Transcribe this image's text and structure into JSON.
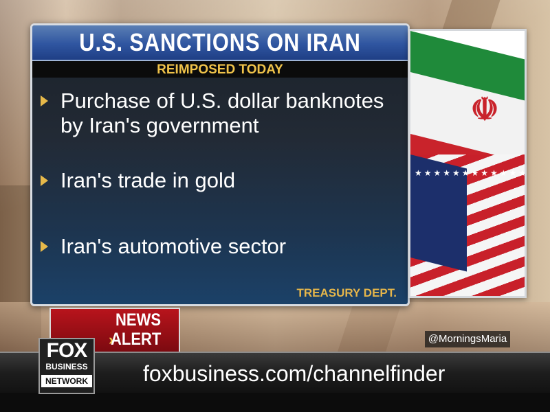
{
  "card": {
    "title": "U.S. SANCTIONS ON IRAN",
    "subtitle": "REIMPOSED TODAY",
    "bullets": [
      "Purchase of U.S. dollar banknotes by Iran's government",
      "Iran's trade in gold",
      "Iran's automotive sector"
    ],
    "source": "TREASURY DEPT."
  },
  "news_alert": {
    "line1": "NEWS",
    "line2": "ALERT",
    "chevron": "›"
  },
  "handle": "@MorningsMaria",
  "ticker": {
    "url": "foxbusiness.com/channelfinder"
  },
  "logo": {
    "line1": "FOX",
    "line2": "BUSINESS",
    "line3": "NETWORK"
  },
  "flags": {
    "iran_emblem": "☫",
    "us_stars": "★★★★★★★★★★★★★★★★★★★★★★★★★★★★★★★★★★★★★★★★"
  },
  "colors": {
    "title_bar": "#2f55a0",
    "subtitle_text": "#f0c34a",
    "bullet_arrow": "#e7b94a",
    "alert_red": "#b8141c"
  }
}
